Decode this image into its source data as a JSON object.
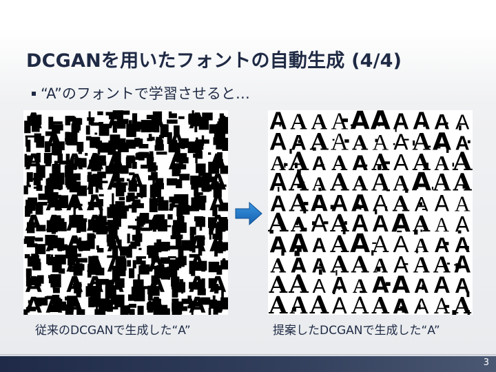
{
  "slide": {
    "title": "DCGANを用いたフォントの自動生成 (4/4)",
    "bullet": "“A”のフォントで学習させると…",
    "page_number": "3"
  },
  "figures": {
    "left_caption": "従来のDCGANで生成した“A”",
    "right_caption": "提案したDCGANで生成した“A”",
    "tile_letter": "A",
    "grid_rows": 10,
    "grid_cols": 10
  },
  "colors": {
    "title": "#1f2a44",
    "arrow": "#1f78c8",
    "footer": "#1e2a48"
  },
  "icons": {
    "arrow": "right-arrow-icon",
    "bullet": "square-bullet-icon"
  }
}
